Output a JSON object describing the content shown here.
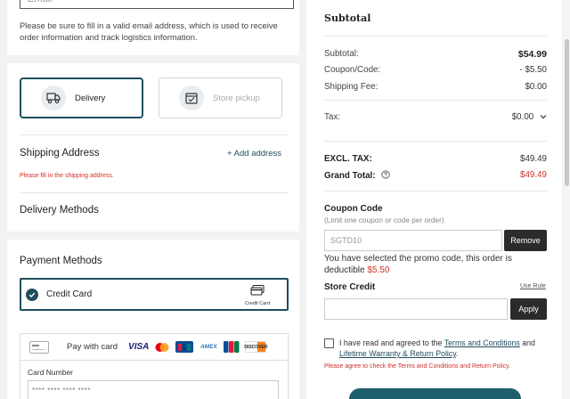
{
  "email": {
    "placeholder": "Email",
    "hint": "Please be sure to fill in a valid email address, which is used to receive order information and track logistics information."
  },
  "shipping": {
    "delivery_label": "Delivery",
    "pickup_label": "Store pickup",
    "address_title": "Shipping Address",
    "add_address": "+ Add address",
    "address_error": "Please fill in the shipping address.",
    "delivery_methods_title": "Delivery Methods",
    "delivery_icon": "truck-icon",
    "pickup_icon": "store-pickup-icon"
  },
  "payment": {
    "title": "Payment Methods",
    "credit_card_label": "Credit Card",
    "credit_card_badge": "Credit Card",
    "pay_with_label": "Pay with card",
    "brands": [
      "VISA",
      "mastercard",
      "JCB",
      "AMEX",
      "JCB",
      "DISCOVER"
    ],
    "card_number_label": "Card Number",
    "card_number_placeholder": "**** **** **** ****"
  },
  "summary": {
    "heading": "Subtotal",
    "rows": [
      {
        "label": "Subtotal:",
        "value": "$54.99"
      },
      {
        "label": "Coupon/Code:",
        "value": "- $5.50"
      },
      {
        "label": "Shipping Fee:",
        "value": "$0.00"
      }
    ],
    "tax_label": "Tax:",
    "tax_value": "$0.00",
    "excl_tax_label": "EXCL. TAX:",
    "excl_tax_value": "$49.49",
    "grand_total_label": "Grand Total:",
    "grand_total_value": "$49.49",
    "coupon_title": "Coupon Code",
    "coupon_sub": "(Limit one coupon or code per order)",
    "coupon_value": "SGTD10",
    "remove_label": "Remove",
    "promo_msg": "You have selected the promo code, this order is deductible",
    "promo_amount": "$5.50",
    "store_credit_title": "Store Credit",
    "use_rule": "Use Rule",
    "apply_label": "Apply",
    "agree_prefix": "I have read and agreed to the",
    "terms_link": "Terms and Conditions",
    "agree_and": "and",
    "warranty_link": "Lifetime Warranty & Return Policy",
    "agree_suffix": ".",
    "agree_error": "Please agree to check the Terms and Conditions and Return Policy."
  },
  "colors": {
    "accent": "#1f4e5e",
    "error": "#d0302a",
    "dark_button": "#2b2b2b"
  }
}
